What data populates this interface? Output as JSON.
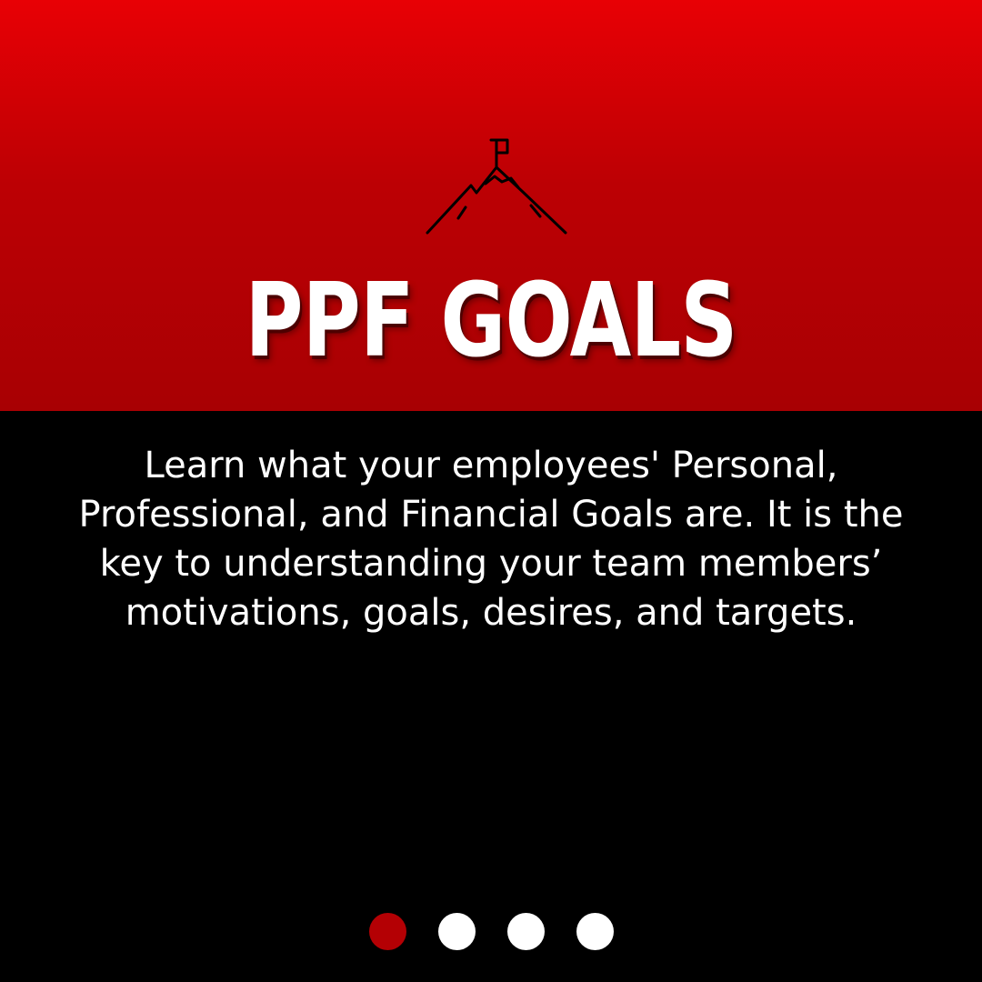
{
  "header": {
    "icon": "mountain-flag-icon",
    "title": "PPF GOALS"
  },
  "body": {
    "text": "Learn what your employees' Personal, Professional, and Financial Goals are. It is the key to understanding your team members’ motivations, goals, desires, and targets."
  },
  "pager": {
    "total": 4,
    "active_index": 0
  },
  "colors": {
    "accent_red": "#c00004",
    "background_black": "#000000",
    "text_white": "#ffffff"
  }
}
